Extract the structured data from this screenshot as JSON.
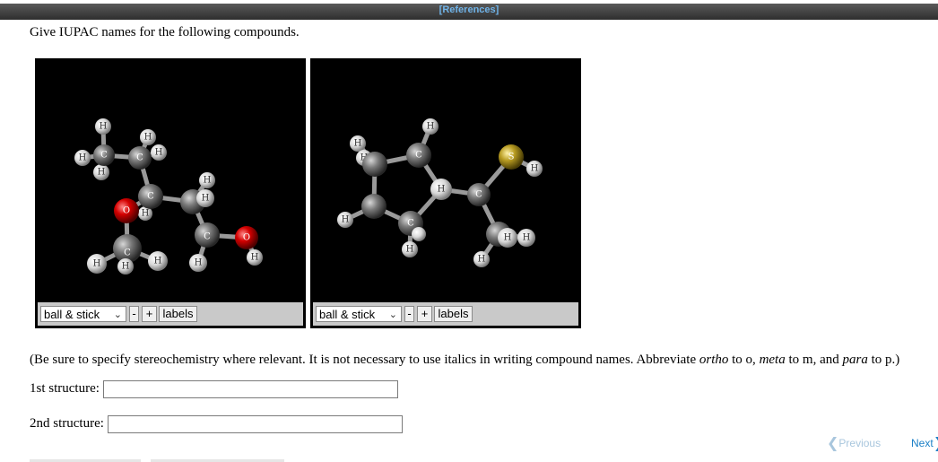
{
  "header": {
    "references_label": "[References]"
  },
  "question": {
    "prompt": "Give IUPAC names for the following compounds.",
    "note_parts": [
      "(Be sure to specify stereochemistry where relevant. It is not necessary to use italics in writing compound names. Abbreviate ",
      "ortho",
      " to o, ",
      "meta",
      " to m, and ",
      "para",
      " to p.)"
    ]
  },
  "viewers": [
    {
      "mode": "ball & stick",
      "minus": "-",
      "plus": "+",
      "labels": "labels",
      "atoms": {
        "carbon": "C",
        "hydrogen": "H",
        "oxygen": "O"
      }
    },
    {
      "mode": "ball & stick",
      "minus": "-",
      "plus": "+",
      "labels": "labels",
      "atoms": {
        "carbon": "C",
        "hydrogen": "H",
        "sulfur": "S"
      }
    }
  ],
  "answers": [
    {
      "label": "1st structure:",
      "value": ""
    },
    {
      "label": "2nd structure:",
      "value": ""
    }
  ],
  "navigation": {
    "previous": "Previous",
    "next": "Next"
  },
  "colors": {
    "carbon": "#6e6e6e",
    "hydrogen": "#e8e8e8",
    "oxygen": "#d40000",
    "sulfur": "#b89c22",
    "background": "#000000",
    "link": "#1a7fc6"
  }
}
